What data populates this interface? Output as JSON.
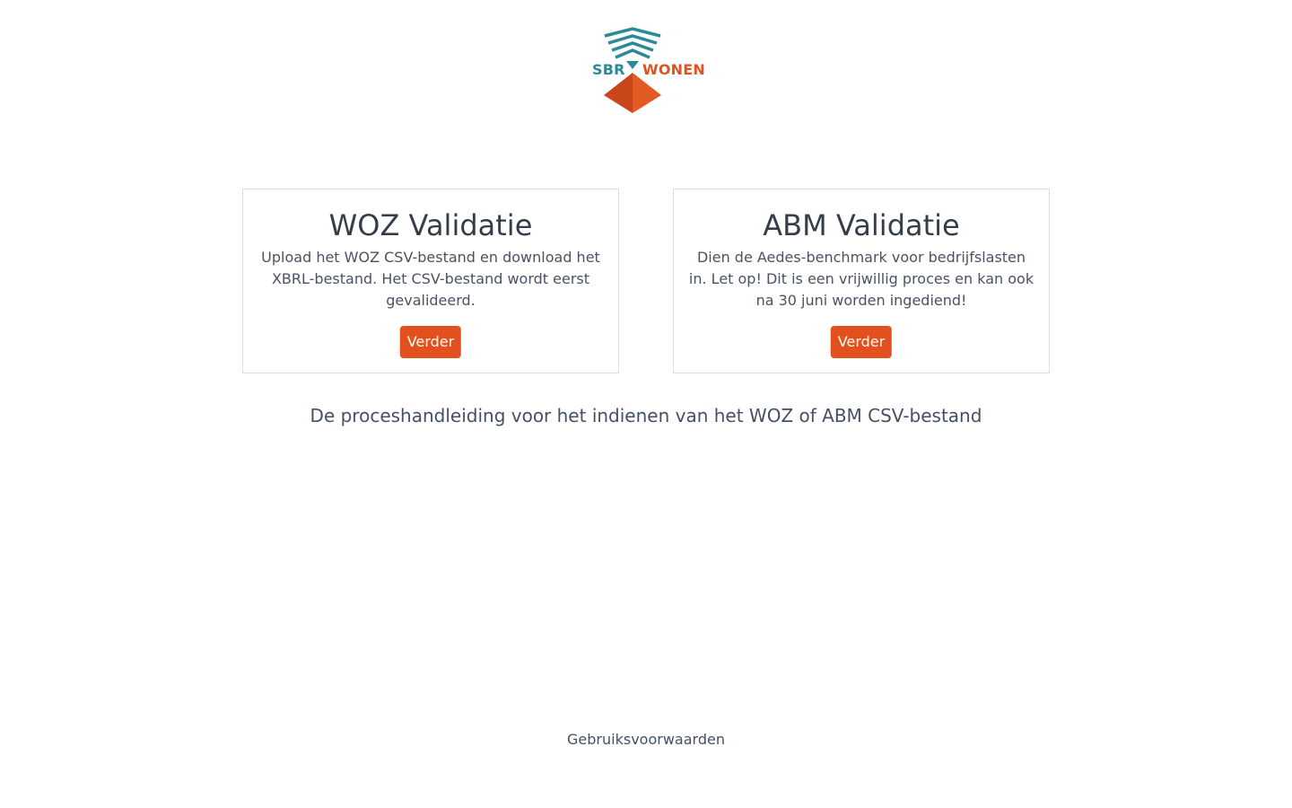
{
  "logo": {
    "word_left": "SBR",
    "word_right": "WONEN",
    "teal": "#2a8a98",
    "orange": "#e0521e"
  },
  "cards": [
    {
      "title": "WOZ Validatie",
      "description": "Upload het WOZ CSV-bestand en download het XBRL-bestand. Het CSV-bestand wordt eerst gevalideerd.",
      "button_label": "Verder"
    },
    {
      "title": "ABM Validatie",
      "description": "Dien de Aedes-benchmark voor bedrijfslasten in. Let op! Dit is een vrijwillig proces en kan ook na 30 juni worden ingediend!",
      "button_label": "Verder"
    }
  ],
  "guide_link": "De proceshandleiding voor het indienen van het WOZ of ABM CSV-bestand",
  "footer": {
    "terms_link": "Gebruiksvoorwaarden"
  },
  "colors": {
    "accent": "#e2501d",
    "text": "#3a4250",
    "border": "#dcdcdc"
  }
}
